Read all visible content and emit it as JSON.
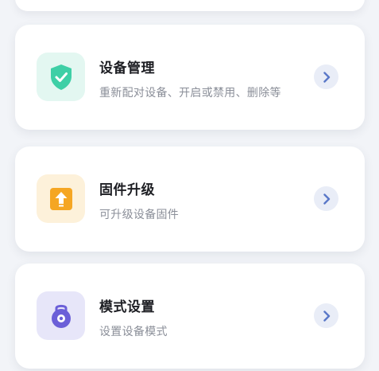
{
  "menu": {
    "items": [
      {
        "title": "设备管理",
        "desc": "重新配对设备、开启或禁用、删除等",
        "icon": "shield-check-icon",
        "icon_color": "#3ecfa6",
        "tile_color": "#e3f7f1"
      },
      {
        "title": "固件升级",
        "desc": "可升级设备固件",
        "icon": "upgrade-arrow-icon",
        "icon_color": "#f5a623",
        "tile_color": "#fdf1da"
      },
      {
        "title": "模式设置",
        "desc": "设置设备模式",
        "icon": "mode-lock-icon",
        "icon_color": "#6b5fd8",
        "tile_color": "#e7e6f9"
      }
    ]
  },
  "colors": {
    "background": "#f2f4f8",
    "card": "#ffffff",
    "chevron": "#5a78c8",
    "chevron_bg": "#e9edf7"
  }
}
